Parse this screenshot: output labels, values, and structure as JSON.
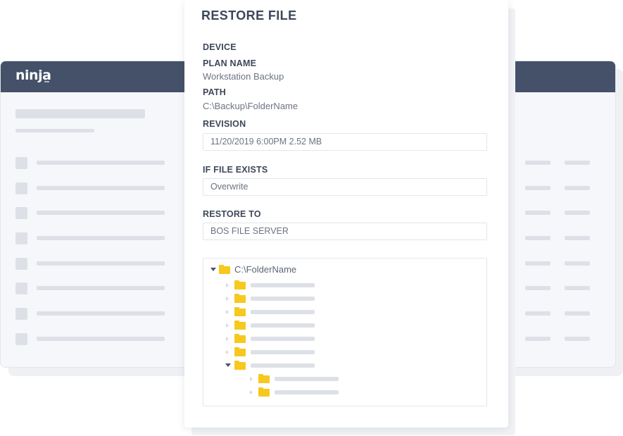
{
  "app": {
    "logo": "ninja"
  },
  "dialog": {
    "title": "RESTORE FILE",
    "device_label": "DEVICE",
    "plan_name_label": "PLAN NAME",
    "plan_name_value": "Workstation Backup",
    "path_label": "PATH",
    "path_value": "C:\\Backup\\FolderName",
    "revision_label": "REVISION",
    "revision_value": "11/20/2019 6:00PM 2.52 MB",
    "if_file_exists_label": "IF FILE EXISTS",
    "if_file_exists_value": "Overwrite",
    "restore_to_label": "RESTORE TO",
    "restore_to_value": "BOS FILE SERVER",
    "tree": {
      "root_label": "C:\\FolderName",
      "root_expanded": true,
      "children_collapsed_count": 6,
      "expanded_child_subfolder_count": 2
    }
  },
  "colors": {
    "header": "#445168",
    "folder": "#f7c81e",
    "text_dark": "#3d4759",
    "text_muted": "#6b7383",
    "placeholder": "#dde0e6"
  },
  "icons": {
    "folder": "folder-icon",
    "expand": "caret-down-icon",
    "collapse": "caret-right-icon"
  }
}
